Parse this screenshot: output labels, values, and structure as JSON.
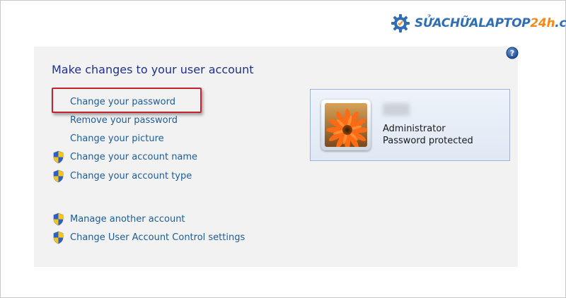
{
  "watermark": {
    "brand_main": "SỬACHỮALAPTOP",
    "brand_accent": "24h",
    "brand_suffix": ".com"
  },
  "title": "Make changes to your user account",
  "links": [
    {
      "label": "Change your password",
      "shield": false,
      "highlighted": true
    },
    {
      "label": "Remove your password",
      "shield": false
    },
    {
      "label": "Change your picture",
      "shield": false
    },
    {
      "label": "Change your account name",
      "shield": true
    },
    {
      "label": "Change your account type",
      "shield": true
    }
  ],
  "other_links": [
    {
      "label": "Manage another account",
      "shield": true
    },
    {
      "label": "Change User Account Control settings",
      "shield": true
    }
  ],
  "account": {
    "role": "Administrator",
    "status": "Password protected"
  },
  "colors": {
    "title": "#1e3287",
    "link": "#1e5c96",
    "highlight_border": "#c0252e",
    "panel_bg": "#f2f2f2",
    "logo_blue": "#2f6db4",
    "logo_orange": "#f08a1c"
  },
  "icons": [
    "gear-logo-icon",
    "help-icon",
    "uac-shield-icon",
    "flower-avatar"
  ]
}
